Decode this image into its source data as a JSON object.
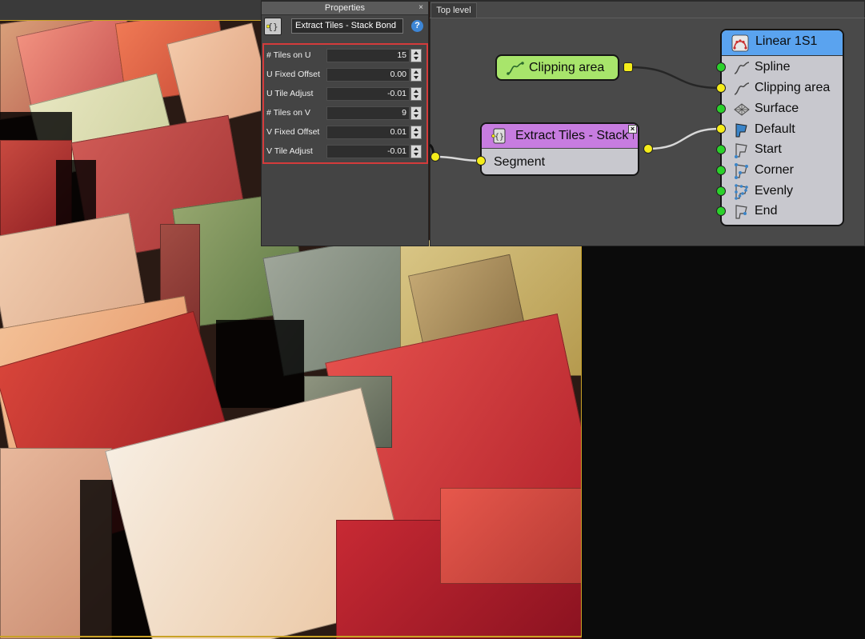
{
  "properties": {
    "title": "Properties",
    "close_glyph": "×",
    "node_name": "Extract Tiles - Stack Bond",
    "help_glyph": "?",
    "params": [
      {
        "label": "# Tiles on U",
        "value": "15"
      },
      {
        "label": "U Fixed Offset",
        "value": "0.00"
      },
      {
        "label": "U Tile Adjust",
        "value": "-0.01"
      },
      {
        "label": "# Tiles on V",
        "value": "9"
      },
      {
        "label": "V Fixed Offset",
        "value": "0.01"
      },
      {
        "label": "V Tile Adjust",
        "value": "-0.01"
      }
    ]
  },
  "graph": {
    "tab_label": "Top level",
    "clipping_node": {
      "label": "Clipping area",
      "icon": "spline-icon"
    },
    "extract_node": {
      "title": "Extract Tiles - Stack Bond",
      "close_glyph": "×",
      "input": "Segment",
      "icon": "extract-tiles-icon"
    },
    "linear_node": {
      "title": "Linear 1S1",
      "icon": "linear-distribution-icon",
      "inputs": [
        {
          "label": "Spline",
          "port": "green",
          "icon": "spline-icon"
        },
        {
          "label": "Clipping area",
          "port": "yellow",
          "icon": "spline-icon"
        },
        {
          "label": "Surface",
          "port": "green",
          "icon": "surface-icon"
        },
        {
          "label": "Default",
          "port": "yellow",
          "icon": "default-shape-icon"
        },
        {
          "label": "Start",
          "port": "green",
          "icon": "start-shape-icon"
        },
        {
          "label": "Corner",
          "port": "green",
          "icon": "corner-shape-icon"
        },
        {
          "label": "Evenly",
          "port": "green",
          "icon": "evenly-shape-icon"
        },
        {
          "label": "End",
          "port": "green",
          "icon": "end-shape-icon"
        }
      ]
    }
  },
  "colors": {
    "highlight_border": "#d43b3b",
    "port_yellow": "#f4ec1a",
    "port_green": "#2bd12b",
    "clip_node": "#a8e56b",
    "extract_header": "#c77ce0",
    "linear_header": "#5aa3ef",
    "viewport_border": "#c9a226"
  }
}
